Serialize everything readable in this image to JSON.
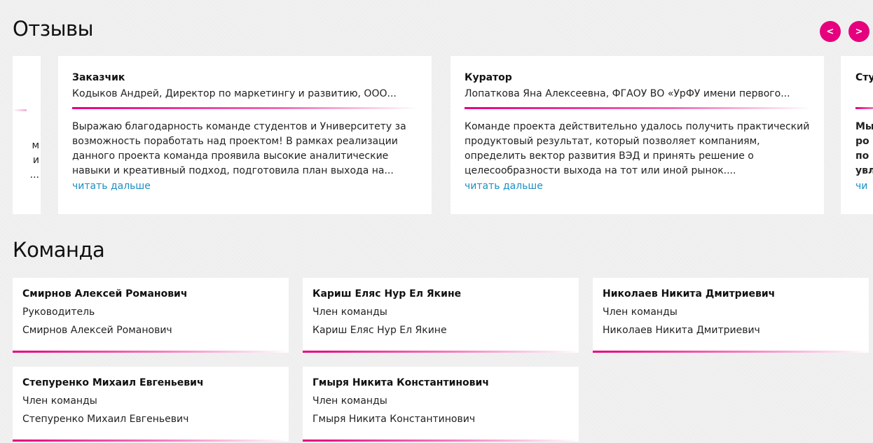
{
  "reviews": {
    "title": "Отзывы",
    "prev_label": "<",
    "next_label": ">",
    "partial_left_lines": [
      "м",
      "и",
      "..."
    ],
    "items": [
      {
        "role": "Заказчик",
        "author": "Кодыков Андрей, Директор по маркетингу и развитию, ООО...",
        "text": "Выражаю благодарность команде студентов и Университету за возможность поработать над проектом! В рамках реализации данного проекта команда проявила высокие аналитические навыки и креативный подход, подготовила план выхода на...",
        "read_more": "читать дальше"
      },
      {
        "role": "Куратор",
        "author": "Лопаткова Яна Алексеевна, ФГАОУ ВО «УрФУ имени первого...",
        "text": "Команде проекта действительно удалось получить практический продуктовый результат, который позволяет компаниям, определить вектор развития ВЭД и принять решение о целесообразности выхода на тот или иной рынок....",
        "read_more": "читать дальше"
      }
    ],
    "partial_right": {
      "role": "Сту",
      "lines": [
        "Мы",
        "ро",
        "по",
        "увл"
      ],
      "read_more": "чи"
    }
  },
  "team": {
    "title": "Команда",
    "members": [
      {
        "name": "Смирнов Алексей Романович",
        "role": "Руководитель",
        "full": "Смирнов Алексей Романович"
      },
      {
        "name": "Кариш Еляс Нур Ел Якине",
        "role": "Член команды",
        "full": "Кариш Еляс Нур Ел Якине"
      },
      {
        "name": "Николаев Никита Дмитриевич",
        "role": "Член команды",
        "full": "Николаев Никита Дмитриевич"
      },
      {
        "name": "Степуренко Михаил Евгеньевич",
        "role": "Член команды",
        "full": "Степуренко Михаил Евгеньевич"
      },
      {
        "name": "Гмыря Никита Константинович",
        "role": "Член команды",
        "full": "Гмыря Никита Константинович"
      }
    ]
  },
  "colors": {
    "accent": "#e6007e",
    "link": "#1a8fc6",
    "background": "#f1f1f1"
  }
}
